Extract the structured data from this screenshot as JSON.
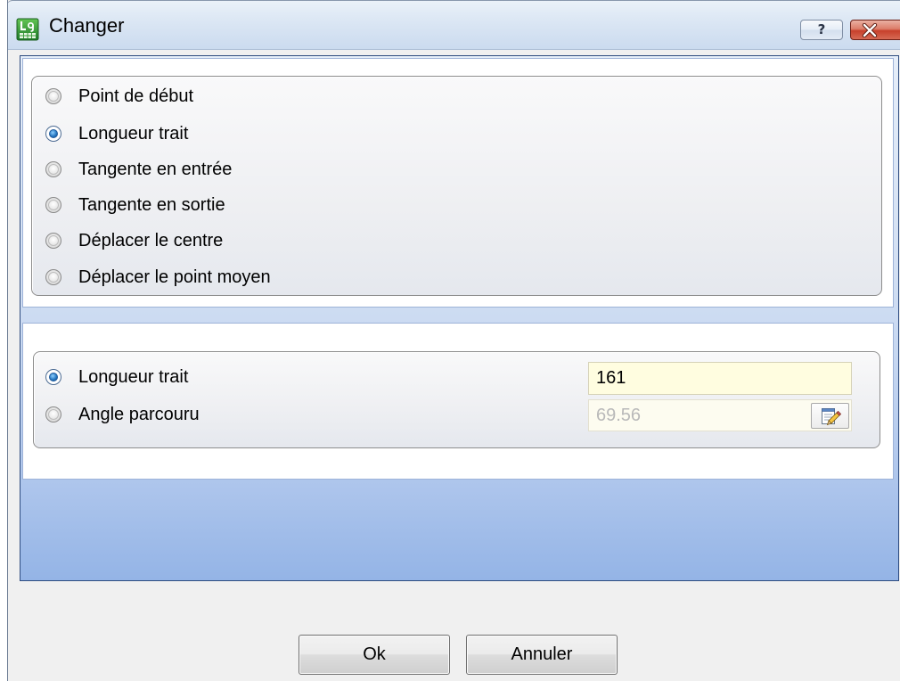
{
  "window": {
    "title": "Changer",
    "help_label": "?",
    "icons": {
      "app": "app-icon",
      "close": "close-icon"
    }
  },
  "mode_group": {
    "selected_index": 1,
    "options": [
      "Point de début",
      "Longueur trait",
      "Tangente en entrée",
      "Tangente en sortie",
      "Déplacer le centre",
      "Déplacer le point moyen"
    ]
  },
  "params_group": {
    "selected_index": 0,
    "rows": [
      {
        "label": "Longueur trait",
        "value": "161",
        "enabled": true
      },
      {
        "label": "Angle parcouru",
        "value": "69.56",
        "enabled": false,
        "action_icon": "edit-notepad-icon"
      }
    ]
  },
  "buttons": {
    "ok_label": "Ok",
    "cancel_label": "Annuler"
  },
  "theme": {
    "panel_border": "#2e4c80",
    "input_background": "#fffde0",
    "selected_radio": "#2a7bc4"
  }
}
